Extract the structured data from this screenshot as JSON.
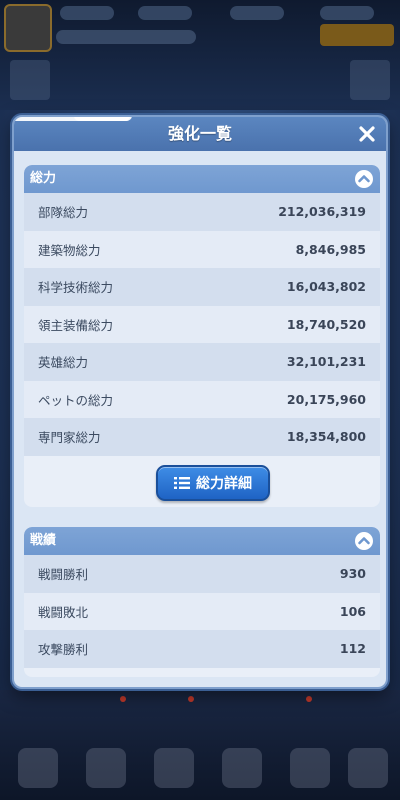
{
  "panel": {
    "title": "強化一覧",
    "close_icon": "close-icon"
  },
  "power_section": {
    "title": "総力",
    "rows": [
      {
        "label": "部隊総力",
        "value": "212,036,319"
      },
      {
        "label": "建築物総力",
        "value": "8,846,985"
      },
      {
        "label": "科学技術総力",
        "value": "16,043,802"
      },
      {
        "label": "領主装備総力",
        "value": "18,740,520"
      },
      {
        "label": "英雄総力",
        "value": "32,101,231"
      },
      {
        "label": "ペットの総力",
        "value": "20,175,960"
      },
      {
        "label": "専門家総力",
        "value": "18,354,800"
      }
    ],
    "detail_button": "総力詳細"
  },
  "record_section": {
    "title": "戦績",
    "rows": [
      {
        "label": "戦闘勝利",
        "value": "930"
      },
      {
        "label": "戦闘敗北",
        "value": "106"
      },
      {
        "label": "攻撃勝利",
        "value": "112"
      }
    ]
  },
  "colors": {
    "header_blue": "#4a72ad",
    "section_head": "#6f98cf",
    "button_blue": "#2a74d6"
  }
}
